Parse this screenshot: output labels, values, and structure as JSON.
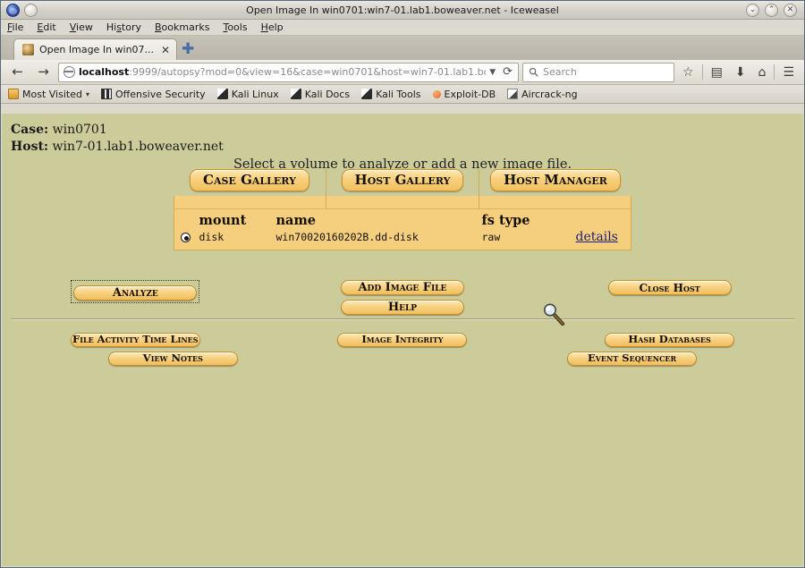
{
  "window": {
    "title": "Open Image In win0701:win7-01.lab1.boweaver.net - Iceweasel",
    "min_glyph": "⌄",
    "max_glyph": "⌃",
    "close_glyph": "✕"
  },
  "menubar": {
    "items": [
      {
        "prefix": "",
        "key": "F",
        "suffix": "ile"
      },
      {
        "prefix": "",
        "key": "E",
        "suffix": "dit"
      },
      {
        "prefix": "",
        "key": "V",
        "suffix": "iew"
      },
      {
        "prefix": "Hi",
        "key": "s",
        "suffix": "tory"
      },
      {
        "prefix": "",
        "key": "B",
        "suffix": "ookmarks"
      },
      {
        "prefix": "",
        "key": "T",
        "suffix": "ools"
      },
      {
        "prefix": "",
        "key": "H",
        "suffix": "elp"
      }
    ]
  },
  "tabs": {
    "active_label": "Open Image In win07...",
    "close_glyph": "✕",
    "newtab_glyph": "✚"
  },
  "navbar": {
    "back_glyph": "←",
    "forward_glyph": "→",
    "url_host": "localhost",
    "url_rest": ":9999/autopsy?mod=0&view=16&case=win0701&host=win7-01.lab1.bo",
    "url_caret": "▼",
    "reload_glyph": "⟳",
    "search_placeholder": "Search",
    "bookmark_glyph": "☆",
    "reader_glyph": "▤",
    "download_glyph": "⬇",
    "home_glyph": "⌂",
    "menu_glyph": "☰"
  },
  "bookmarks": {
    "items": [
      {
        "label": "Most Visited",
        "icon": "folder-icon",
        "caret": "▾"
      },
      {
        "label": "Offensive Security",
        "icon": "bars-icon",
        "caret": ""
      },
      {
        "label": "Kali Linux",
        "icon": "dragon-icon",
        "caret": ""
      },
      {
        "label": "Kali Docs",
        "icon": "dragon-icon",
        "caret": ""
      },
      {
        "label": "Kali Tools",
        "icon": "dragon-icon",
        "caret": ""
      },
      {
        "label": "Exploit-DB",
        "icon": "dot-icon",
        "caret": ""
      },
      {
        "label": "Aircrack-ng",
        "icon": "page-icon",
        "caret": ""
      }
    ]
  },
  "content": {
    "case_label": "Case:",
    "case_value": "win0701",
    "host_label": "Host:",
    "host_value": "win7-01.lab1.boweaver.net",
    "subtitle": "Select a volume to analyze or add a new image file.",
    "gallery_tabs": [
      {
        "label": "Case Gallery"
      },
      {
        "label": "Host Gallery"
      },
      {
        "label": "Host Manager"
      }
    ],
    "table": {
      "headers": [
        "",
        "mount",
        "name",
        "fs type",
        ""
      ],
      "rows": [
        {
          "selected": true,
          "mount": "disk",
          "name": "win70020160202B.dd-disk",
          "fs_type": "raw",
          "details_label": "details"
        }
      ]
    },
    "actions": {
      "analyze": "Analyze",
      "add_image_file": "Add Image File",
      "help": "Help",
      "close_host": "Close Host"
    },
    "tools": {
      "file_activity_time_lines": "File Activity Time Lines",
      "view_notes": "View Notes",
      "image_integrity": "Image Integrity",
      "hash_databases": "Hash Databases",
      "event_sequencer": "Event Sequencer"
    }
  },
  "colors": {
    "page_bg": "#cccb9a",
    "panel_fill": "#f6cf7e",
    "panel_border": "#d7a94e",
    "button_gold": "#f8d488",
    "link": "#1c1c7a"
  }
}
